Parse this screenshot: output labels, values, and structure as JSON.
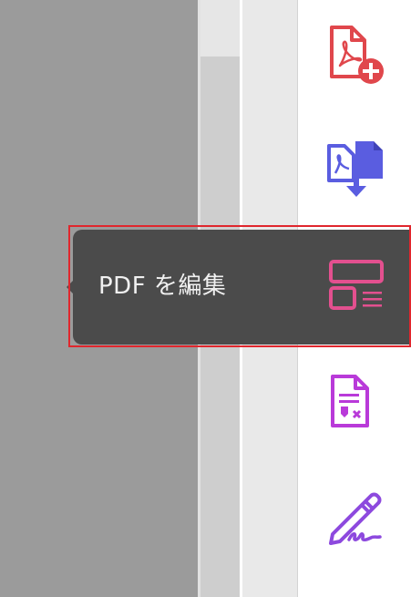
{
  "sidebar": {
    "tools": [
      {
        "name": "create-pdf",
        "icon": "create-pdf-icon",
        "color": "#e0474c"
      },
      {
        "name": "export-pdf",
        "icon": "export-pdf-icon",
        "color": "#5a5de0"
      },
      {
        "name": "edit-pdf",
        "icon": "edit-pdf-icon",
        "color": "#e3508f"
      },
      {
        "name": "fill-sign",
        "icon": "fill-sign-icon",
        "color": "#b93ad9"
      },
      {
        "name": "sign",
        "icon": "sign-icon",
        "color": "#8d49de"
      }
    ]
  },
  "tooltip": {
    "label": "PDF を編集"
  },
  "highlight": {
    "color": "#e0262d"
  }
}
